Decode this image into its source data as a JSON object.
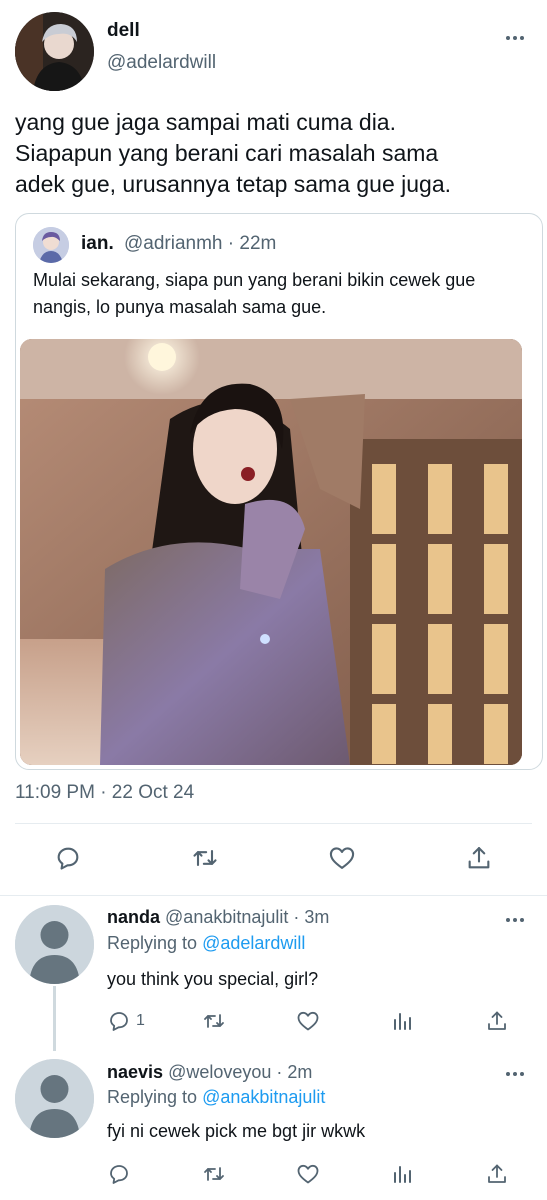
{
  "main_tweet": {
    "display_name": "dell",
    "handle": "@adelardwill",
    "text": "yang gue jaga sampai mati cuma dia.\nSiapapun yang berani cari masalah sama\nadek gue, urusannya tetap sama gue juga.",
    "timestamp": "11:09 PM · 22 Oct 24",
    "quote": {
      "display_name": "ian.",
      "meta": "@adrianmh · 22m",
      "text": "Mulai sekarang, siapa pun yang berani bikin cewek gue nangis, lo punya masalah sama gue."
    }
  },
  "replies": [
    {
      "display_name": "nanda",
      "meta": "@anakbitnajulit · 3m",
      "replying_prefix": "Replying to ",
      "replying_to": "@adelardwill",
      "text": "you think you special, girl?",
      "reply_count": "1"
    },
    {
      "display_name": "naevis",
      "meta": "@weloveyou · 2m",
      "replying_prefix": "Replying to ",
      "replying_to": "@anakbitnajulit",
      "text": "fyi ni cewek pick me bgt jir wkwk",
      "reply_count": ""
    }
  ],
  "colors": {
    "accent": "#1d9bf0",
    "text_primary": "#0f1419",
    "text_secondary": "#536471",
    "border": "#cfd9de"
  },
  "icons": [
    "reply-icon",
    "retweet-icon",
    "like-icon",
    "analytics-icon",
    "share-icon",
    "more-icon",
    "default-avatar-icon"
  ]
}
